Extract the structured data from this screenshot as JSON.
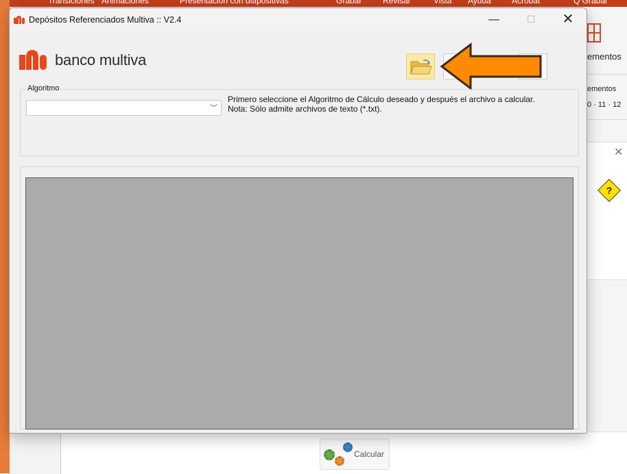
{
  "background_app": {
    "ribbon_tabs": [
      "Transiciones",
      "Animaciones",
      "Presentación con diapositivas",
      "Grabar",
      "Revisar",
      "Vista",
      "Ayuda",
      "Acrobat",
      "Q Grabar"
    ],
    "ribbon_label_1": "ementos",
    "ribbon_label_2": "ementos",
    "ruler_text": "0 · 11 · 12"
  },
  "dialog_bottom": {
    "calculate_label": "Calcular"
  },
  "window": {
    "title": "Depósitos Referenciados Multiva :: V2.4",
    "controls": {
      "minimize": "—",
      "maximize": "☐",
      "close": "✕"
    }
  },
  "brand": {
    "name": "banco multiva"
  },
  "algoritmo": {
    "label": "Algoritmo",
    "selected_value": "",
    "instructions_line1": "Primero seleccione el Algoritmo de Cálculo deseado y después el archivo a calcular.",
    "instructions_line2": "Nota: Sólo admite archivos de texto (*.txt)."
  },
  "colors": {
    "brand_orange": "#e8461b",
    "arrow_fill": "#ff8a00",
    "arrow_stroke": "#3b2a1a",
    "results_bg": "#ababab"
  },
  "icons": {
    "folder": "folder-open-icon",
    "arrow": "arrow-left-icon",
    "help": "help-diamond-icon"
  }
}
